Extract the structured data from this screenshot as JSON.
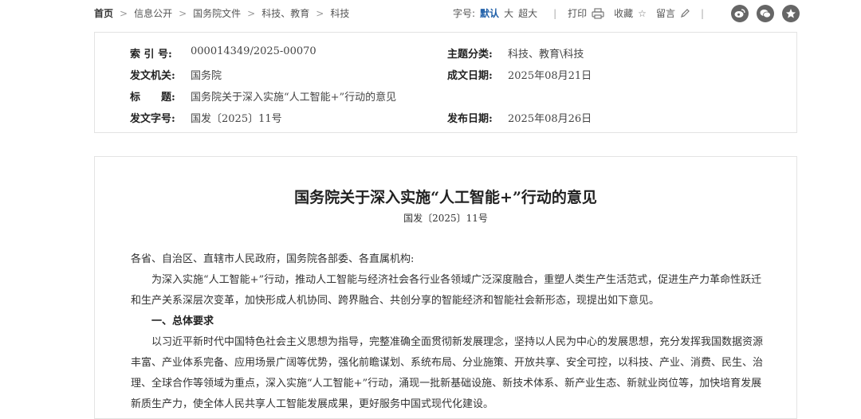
{
  "breadcrumb": [
    "首页",
    "信息公开",
    "国务院文件",
    "科技、教育",
    "科技"
  ],
  "toolbar": {
    "font_size_label": "字号:",
    "font_default": "默认",
    "font_large": "大",
    "font_xlarge": "超大",
    "print": "打印",
    "favorite": "收藏",
    "comment": "留言"
  },
  "social": [
    "weibo-icon",
    "wechat-icon",
    "star-icon"
  ],
  "meta": {
    "index_label": "索 引 号:",
    "index_value": "000014349/2025-00070",
    "topic_label": "主题分类:",
    "topic_value": "科技、教育\\科技",
    "issuer_label": "发文机关:",
    "issuer_value": "国务院",
    "date_label": "成文日期:",
    "date_value": "2025年08月21日",
    "title_label": "标　　题:",
    "title_value": "国务院关于深入实施“人工智能+”行动的意见",
    "docnum_label": "发文字号:",
    "docnum_value": "国发〔2025〕11号",
    "pubdate_label": "发布日期:",
    "pubdate_value": "2025年08月26日"
  },
  "article": {
    "title": "国务院关于深入实施“人工智能+”行动的意见",
    "docno": "国发〔2025〕11号",
    "salutation": "各省、自治区、直辖市人民政府，国务院各部委、各直属机构:",
    "p1": "为深入实施“人工智能+”行动，推动人工智能与经济社会各行业各领域广泛深度融合，重塑人类生产生活范式，促进生产力革命性跃迁和生产关系深层次变革，加快形成人机协同、跨界融合、共创分享的智能经济和智能社会新形态，现提出如下意见。",
    "h1": "一、总体要求",
    "p2": "以习近平新时代中国特色社会主义思想为指导，完整准确全面贯彻新发展理念，坚持以人民为中心的发展思想，充分发挥我国数据资源丰富、产业体系完备、应用场景广阔等优势，强化前瞻谋划、系统布局、分业施策、开放共享、安全可控，以科技、产业、消费、民生、治理、全球合作等领域为重点，深入实施“人工智能+”行动，涌现一批新基础设施、新技术体系、新产业生态、新就业岗位等，加快培育发展新质生产力，使全体人民共享人工智能发展成果，更好服务中国式现代化建设。"
  }
}
